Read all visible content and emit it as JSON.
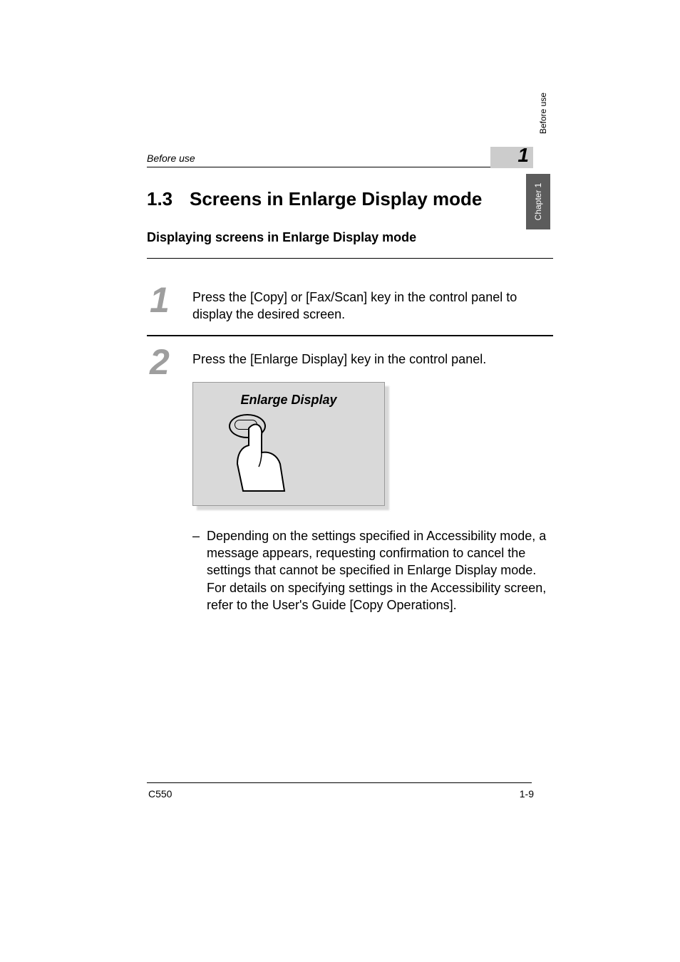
{
  "running_head": "Before use",
  "chapter_badge_num": "1",
  "side_tab": "Chapter 1",
  "side_label": "Before use",
  "section": {
    "number": "1.3",
    "title": "Screens in Enlarge Display mode"
  },
  "sub_heading": "Displaying screens in Enlarge Display mode",
  "steps": [
    {
      "num": "1",
      "text": "Press the [Copy] or [Fax/Scan] key in the control panel to display the desired screen."
    },
    {
      "num": "2",
      "text": "Press the [Enlarge Display] key in the control panel."
    }
  ],
  "illustration_title": "Enlarge Display",
  "bullet": "Depending on the settings specified in Accessibility mode, a message appears, requesting confirmation to cancel the settings that cannot be specified in Enlarge Display mode. For details on specifying settings in the Accessibility screen, refer to the User's Guide [Copy Operations].",
  "footer": {
    "left": "C550",
    "right": "1-9"
  }
}
